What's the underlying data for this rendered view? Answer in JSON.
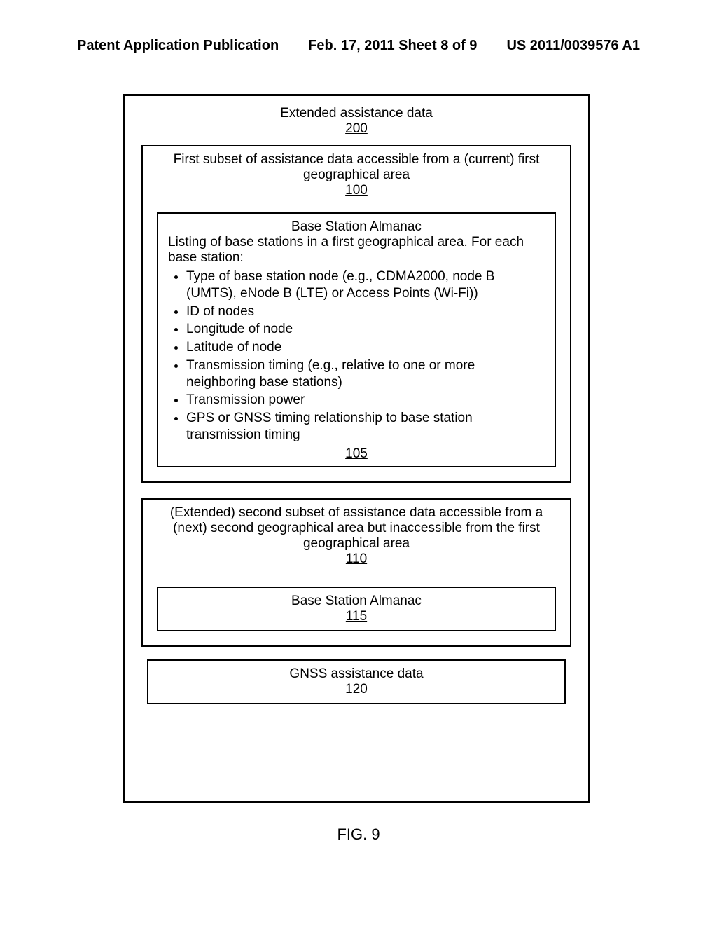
{
  "header": {
    "left": "Patent Application Publication",
    "mid": "Feb. 17, 2011  Sheet 8 of 9",
    "right": "US 2011/0039576 A1"
  },
  "outer": {
    "title": "Extended assistance data",
    "ref": "200"
  },
  "subset1": {
    "title": "First subset of assistance data accessible from a (current) first geographical area",
    "ref": "100",
    "almanac": {
      "heading": "Base Station Almanac",
      "intro": "Listing of base stations in a first geographical area. For each base station:",
      "items": [
        "Type of base station node (e.g., CDMA2000, node B (UMTS), eNode B (LTE) or Access Points (Wi-Fi))",
        "ID of nodes",
        "Longitude of node",
        "Latitude of node",
        "Transmission timing (e.g., relative to one or more neighboring base stations)",
        "Transmission power",
        "GPS or GNSS timing relationship to base station transmission timing"
      ],
      "ref": "105"
    }
  },
  "subset2": {
    "title": "(Extended) second subset of assistance data accessible from a (next) second geographical area but inaccessible from the first geographical area",
    "ref": "110",
    "almanac": {
      "heading": "Base Station Almanac",
      "ref": "115"
    }
  },
  "gnss": {
    "title": "GNSS assistance data",
    "ref": "120"
  },
  "figure": "FIG. 9"
}
